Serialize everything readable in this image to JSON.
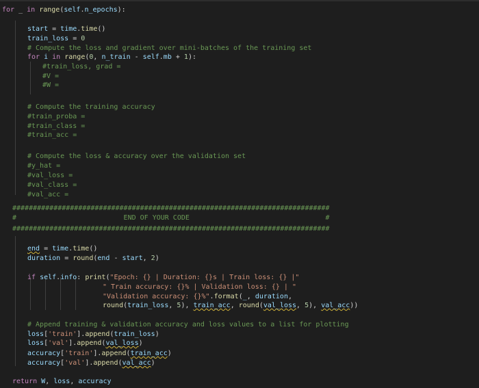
{
  "editor": {
    "lines": [
      {
        "indent": 3,
        "tokens": [
          [
            "kw",
            "for"
          ],
          [
            "tx",
            " _ "
          ],
          [
            "kw",
            "in"
          ],
          [
            "tx",
            " "
          ],
          [
            "fn",
            "range"
          ],
          [
            "tx",
            "("
          ],
          [
            "vr",
            "self"
          ],
          [
            "tx",
            "."
          ],
          [
            "vr",
            "n_epochs"
          ],
          [
            "tx",
            "):"
          ]
        ]
      },
      {
        "indent": 40,
        "tokens": [
          [
            "vr",
            "start"
          ],
          [
            "tx",
            " = "
          ],
          [
            "vr",
            "time"
          ],
          [
            "tx",
            "."
          ],
          [
            "fn",
            "time"
          ],
          [
            "tx",
            "()"
          ]
        ]
      },
      {
        "indent": 40,
        "tokens": [
          [
            "vr",
            "train_loss"
          ],
          [
            "tx",
            " = "
          ],
          [
            "nm",
            "0"
          ]
        ]
      },
      {
        "indent": 40,
        "tokens": [
          [
            "cm",
            "# Compute the loss and gradient over mini-batches of the training set"
          ]
        ]
      },
      {
        "indent": 40,
        "tokens": [
          [
            "kw",
            "for"
          ],
          [
            "tx",
            " "
          ],
          [
            "vr",
            "i"
          ],
          [
            "tx",
            " "
          ],
          [
            "kw",
            "in"
          ],
          [
            "tx",
            " "
          ],
          [
            "fn",
            "range"
          ],
          [
            "tx",
            "("
          ],
          [
            "nm",
            "0"
          ],
          [
            "tx",
            ", "
          ],
          [
            "vr",
            "n_train"
          ],
          [
            "tx",
            " - "
          ],
          [
            "vr",
            "self"
          ],
          [
            "tx",
            "."
          ],
          [
            "vr",
            "mb"
          ],
          [
            "tx",
            " + "
          ],
          [
            "nm",
            "1"
          ],
          [
            "tx",
            "):"
          ]
        ]
      },
      {
        "indent": 62,
        "tokens": [
          [
            "cm",
            "#train_loss, grad ="
          ]
        ]
      },
      {
        "indent": 62,
        "tokens": [
          [
            "cm",
            "#V ="
          ]
        ]
      },
      {
        "indent": 62,
        "tokens": [
          [
            "cm",
            "#W ="
          ]
        ]
      },
      {
        "indent": 40,
        "tokens": []
      },
      {
        "indent": 40,
        "tokens": [
          [
            "cm",
            "# Compute the training accuracy"
          ]
        ]
      },
      {
        "indent": 40,
        "tokens": [
          [
            "cm",
            "#train_proba ="
          ]
        ]
      },
      {
        "indent": 40,
        "tokens": [
          [
            "cm",
            "#train_class ="
          ]
        ]
      },
      {
        "indent": 40,
        "tokens": [
          [
            "cm",
            "#train_acc ="
          ]
        ]
      },
      {
        "indent": 40,
        "tokens": []
      },
      {
        "indent": 40,
        "tokens": [
          [
            "cm",
            "# Compute the loss & accuracy over the validation set"
          ]
        ]
      },
      {
        "indent": 40,
        "tokens": [
          [
            "cm",
            "#y_hat ="
          ]
        ]
      },
      {
        "indent": 40,
        "tokens": [
          [
            "cm",
            "#val_loss ="
          ]
        ]
      },
      {
        "indent": 40,
        "tokens": [
          [
            "cm",
            "#val_class ="
          ]
        ]
      },
      {
        "indent": 40,
        "tokens": [
          [
            "cm",
            "#val_acc ="
          ]
        ]
      },
      {
        "indent": 40,
        "tokens": []
      },
      {
        "indent": 18,
        "tokens": [
          [
            "cm",
            "#############################################################################"
          ]
        ]
      },
      {
        "indent": 18,
        "tokens": [
          [
            "cm",
            "#                          END OF YOUR CODE                                 #"
          ]
        ]
      },
      {
        "indent": 18,
        "tokens": [
          [
            "cm",
            "#############################################################################"
          ]
        ]
      },
      {
        "indent": 40,
        "tokens": []
      },
      {
        "indent": 40,
        "tokens": [
          [
            "vr",
            "end"
          ],
          [
            "tx",
            " = "
          ],
          [
            "vr",
            "time"
          ],
          [
            "tx",
            "."
          ],
          [
            "fn",
            "time"
          ],
          [
            "tx",
            "()"
          ]
        ]
      },
      {
        "indent": 40,
        "tokens": [
          [
            "vr",
            "duration"
          ],
          [
            "tx",
            " = "
          ],
          [
            "fn",
            "round"
          ],
          [
            "tx",
            "("
          ],
          [
            "vr",
            "end"
          ],
          [
            "tx",
            " - "
          ],
          [
            "vr",
            "start"
          ],
          [
            "tx",
            ", "
          ],
          [
            "nm",
            "2"
          ],
          [
            "tx",
            ")"
          ]
        ]
      },
      {
        "indent": 40,
        "tokens": []
      },
      {
        "indent": 40,
        "tokens": [
          [
            "kw",
            "if"
          ],
          [
            "tx",
            " "
          ],
          [
            "vr",
            "self"
          ],
          [
            "tx",
            "."
          ],
          [
            "vr",
            "info"
          ],
          [
            "tx",
            ": "
          ],
          [
            "fn",
            "print"
          ],
          [
            "tx",
            "("
          ],
          [
            "st",
            "\"Epoch: {} | Duration: {}s | Train loss: {} |\""
          ]
        ]
      },
      {
        "indent": 150,
        "tokens": [
          [
            "st",
            "\" Train accuracy: {}% | Validation loss: {} | \""
          ]
        ]
      },
      {
        "indent": 150,
        "tokens": [
          [
            "st",
            "\"Validation accuracy: {}%\""
          ],
          [
            "tx",
            "."
          ],
          [
            "fn",
            "format"
          ],
          [
            "tx",
            "("
          ],
          [
            "vr",
            "_"
          ],
          [
            "tx",
            ", "
          ],
          [
            "vr",
            "duration"
          ],
          [
            "tx",
            ","
          ]
        ]
      },
      {
        "indent": 150,
        "tokens": [
          [
            "fn",
            "round"
          ],
          [
            "tx",
            "("
          ],
          [
            "vr",
            "train_loss"
          ],
          [
            "tx",
            ", "
          ],
          [
            "nm",
            "5"
          ],
          [
            "tx",
            "), "
          ],
          [
            "vr",
            "train_acc"
          ],
          [
            "tx",
            ", "
          ],
          [
            "fn",
            "round"
          ],
          [
            "tx",
            "("
          ],
          [
            "vr",
            "val_loss"
          ],
          [
            "tx",
            ", "
          ],
          [
            "nm",
            "5"
          ],
          [
            "tx",
            "), "
          ],
          [
            "vr",
            "val_acc"
          ],
          [
            "tx",
            "))"
          ]
        ]
      },
      {
        "indent": 40,
        "tokens": []
      },
      {
        "indent": 40,
        "tokens": [
          [
            "cm",
            "# Append training & validation accuracy and loss values to a list for plotting"
          ]
        ]
      },
      {
        "indent": 40,
        "tokens": [
          [
            "vr",
            "loss"
          ],
          [
            "tx",
            "["
          ],
          [
            "st",
            "'train'"
          ],
          [
            "tx",
            "]."
          ],
          [
            "fn",
            "append"
          ],
          [
            "tx",
            "("
          ],
          [
            "vr",
            "train_loss"
          ],
          [
            "tx",
            ")"
          ]
        ]
      },
      {
        "indent": 40,
        "tokens": [
          [
            "vr",
            "loss"
          ],
          [
            "tx",
            "["
          ],
          [
            "st",
            "'val'"
          ],
          [
            "tx",
            "]."
          ],
          [
            "fn",
            "append"
          ],
          [
            "tx",
            "("
          ],
          [
            "vr",
            "val_loss"
          ],
          [
            "tx",
            ")"
          ]
        ]
      },
      {
        "indent": 40,
        "tokens": [
          [
            "vr",
            "accuracy"
          ],
          [
            "tx",
            "["
          ],
          [
            "st",
            "'train'"
          ],
          [
            "tx",
            "]."
          ],
          [
            "fn",
            "append"
          ],
          [
            "tx",
            "("
          ],
          [
            "vr",
            "train_acc"
          ],
          [
            "tx",
            ")"
          ]
        ]
      },
      {
        "indent": 40,
        "tokens": [
          [
            "vr",
            "accuracy"
          ],
          [
            "tx",
            "["
          ],
          [
            "st",
            "'val'"
          ],
          [
            "tx",
            "]."
          ],
          [
            "fn",
            "append"
          ],
          [
            "tx",
            "("
          ],
          [
            "vr",
            "val_acc"
          ],
          [
            "tx",
            ")"
          ]
        ]
      },
      {
        "indent": 40,
        "tokens": []
      },
      {
        "indent": 18,
        "tokens": [
          [
            "kw",
            "return"
          ],
          [
            "tx",
            " "
          ],
          [
            "vr",
            "W"
          ],
          [
            "tx",
            ", "
          ],
          [
            "vr",
            "loss"
          ],
          [
            "tx",
            ", "
          ],
          [
            "vr",
            "accuracy"
          ]
        ]
      }
    ]
  }
}
